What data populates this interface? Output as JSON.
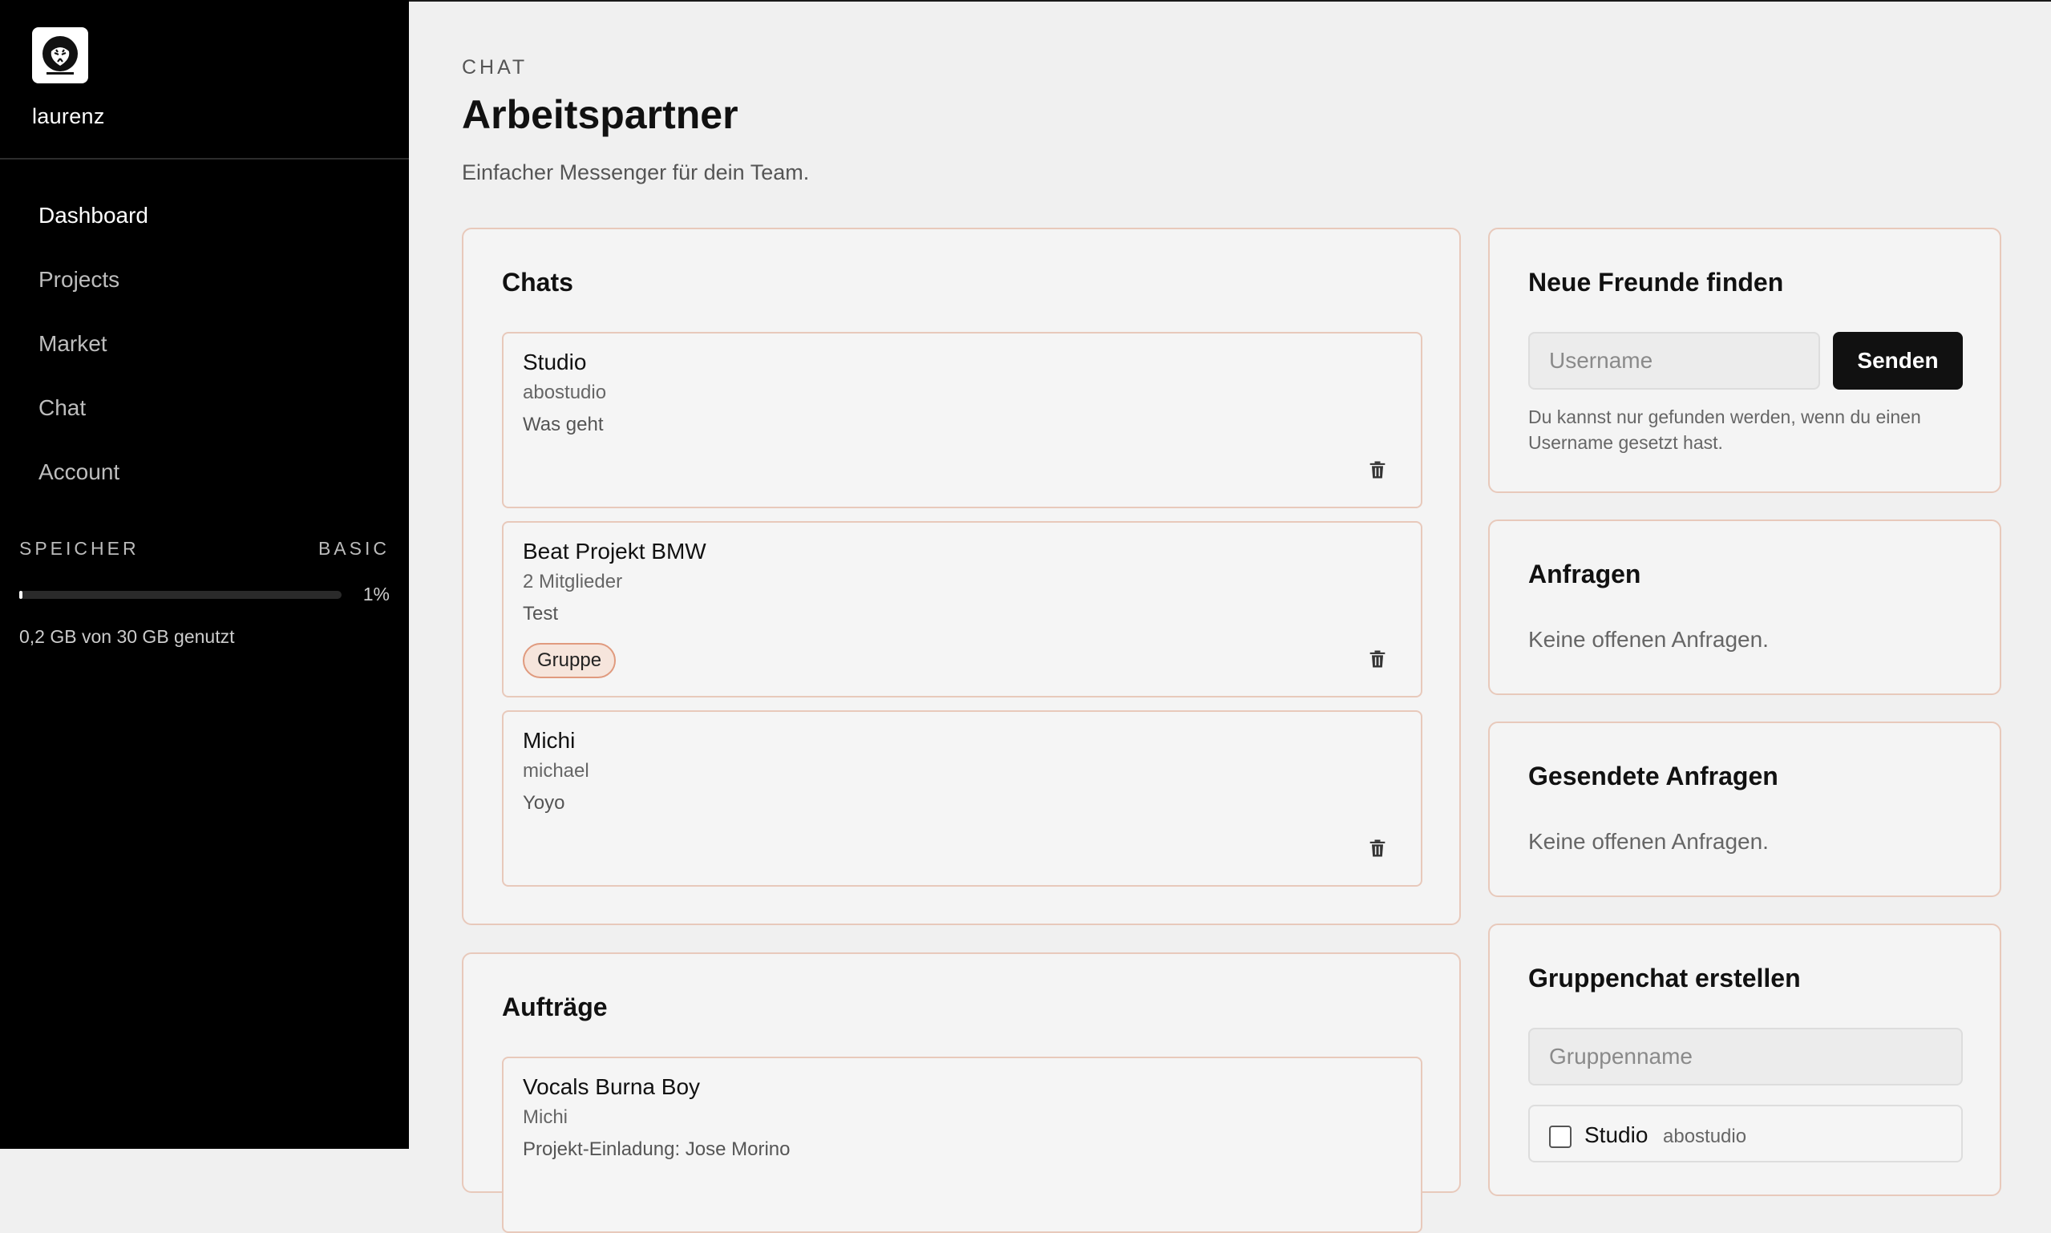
{
  "sidebar": {
    "username": "laurenz",
    "nav": [
      "Dashboard",
      "Projects",
      "Market",
      "Chat",
      "Account"
    ],
    "storage": {
      "label": "SPEICHER",
      "plan": "BASIC",
      "percent_label": "1%",
      "percent_value": 0.01,
      "usage_text": "0,2 GB von 30 GB genutzt"
    }
  },
  "header": {
    "eyebrow": "CHAT",
    "title": "Arbeitspartner",
    "subtitle": "Einfacher Messenger für dein Team."
  },
  "chats": {
    "title": "Chats",
    "items": [
      {
        "name": "Studio",
        "sub": "abostudio",
        "message": "Was geht",
        "tag": ""
      },
      {
        "name": "Beat Projekt BMW",
        "sub": "2 Mitglieder",
        "message": "Test",
        "tag": "Gruppe"
      },
      {
        "name": "Michi",
        "sub": "michael",
        "message": "Yoyo",
        "tag": ""
      }
    ]
  },
  "orders": {
    "title": "Aufträge",
    "items": [
      {
        "name": "Vocals Burna Boy",
        "sub": "Michi",
        "message": "Projekt-Einladung: Jose Morino"
      }
    ]
  },
  "find_friends": {
    "title": "Neue Freunde finden",
    "placeholder": "Username",
    "button": "Senden",
    "hint_line1": "Du kannst nur gefunden werden, wenn du einen",
    "hint_line2": "Username gesetzt hast."
  },
  "requests": {
    "title": "Anfragen",
    "empty": "Keine offenen Anfragen."
  },
  "sent_requests": {
    "title": "Gesendete Anfragen",
    "empty": "Keine offenen Anfragen."
  },
  "group_create": {
    "title": "Gruppenchat erstellen",
    "placeholder": "Gruppenname",
    "members": [
      {
        "name": "Studio",
        "username": "abostudio"
      }
    ]
  }
}
